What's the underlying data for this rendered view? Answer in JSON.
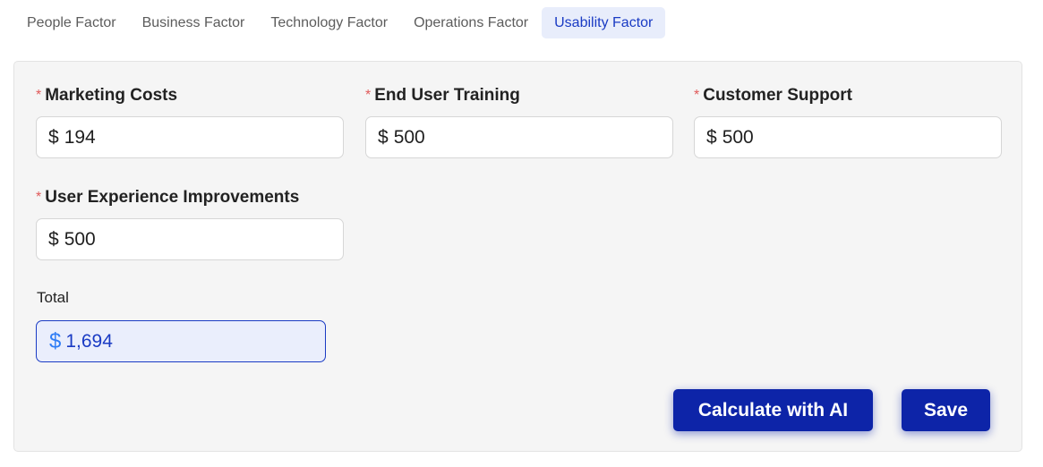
{
  "tabs": [
    {
      "label": "People Factor"
    },
    {
      "label": "Business Factor"
    },
    {
      "label": "Technology Factor"
    },
    {
      "label": "Operations Factor"
    },
    {
      "label": "Usability Factor",
      "active": true
    }
  ],
  "form": {
    "required_marker": "*",
    "currency_symbol": "$",
    "fields": [
      {
        "label": "Marketing Costs",
        "value": "194"
      },
      {
        "label": "End User Training",
        "value": "500"
      },
      {
        "label": "Customer Support",
        "value": "500"
      },
      {
        "label": "User Experience Improvements",
        "value": "500"
      }
    ],
    "total": {
      "label": "Total",
      "value": "1,694"
    }
  },
  "actions": {
    "calculate_label": "Calculate with AI",
    "save_label": "Save"
  },
  "colors": {
    "accent": "#0d24a8",
    "active_tab_bg": "#e8edfb",
    "required": "#e05a5a",
    "total_bg": "#eaeefc",
    "currency_highlight": "#2f7df5"
  }
}
